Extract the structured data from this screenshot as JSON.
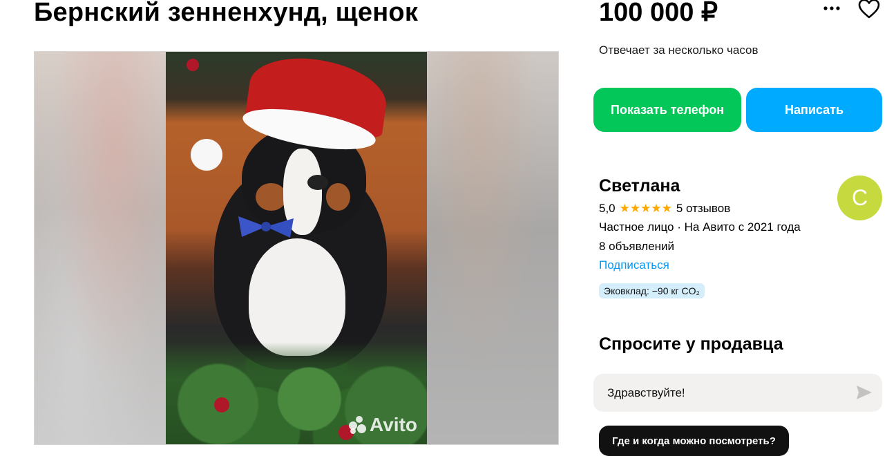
{
  "listing": {
    "title": "Бернский зенненхунд, щенок",
    "price": "100 000 ₽",
    "response_time": "Отвечает за несколько часов"
  },
  "gallery": {
    "watermark": "Avito"
  },
  "actions": {
    "show_phone": "Показать телефон",
    "write": "Написать",
    "more_icon": "more-dots-icon",
    "favorite_icon": "heart-icon"
  },
  "seller": {
    "name": "Светлана",
    "rating": "5,0",
    "stars": "★★★★★",
    "reviews": "5 отзывов",
    "type": "Частное лицо · На Авито с 2021 года",
    "ads_count": "8 объявлений",
    "subscribe": "Подписаться",
    "eco_badge": "Эковклад: −90 кг CO₂",
    "avatar_letter": "С",
    "avatar_color": "#c6d93f"
  },
  "ask": {
    "title": "Спросите у продавца",
    "message_value": "Здравствуйте!",
    "send_icon": "send-icon",
    "suggestion": "Где и когда можно посмотреть?"
  },
  "colors": {
    "green_button": "#04c75a",
    "blue_button": "#00aaff",
    "link": "#0099f7"
  }
}
